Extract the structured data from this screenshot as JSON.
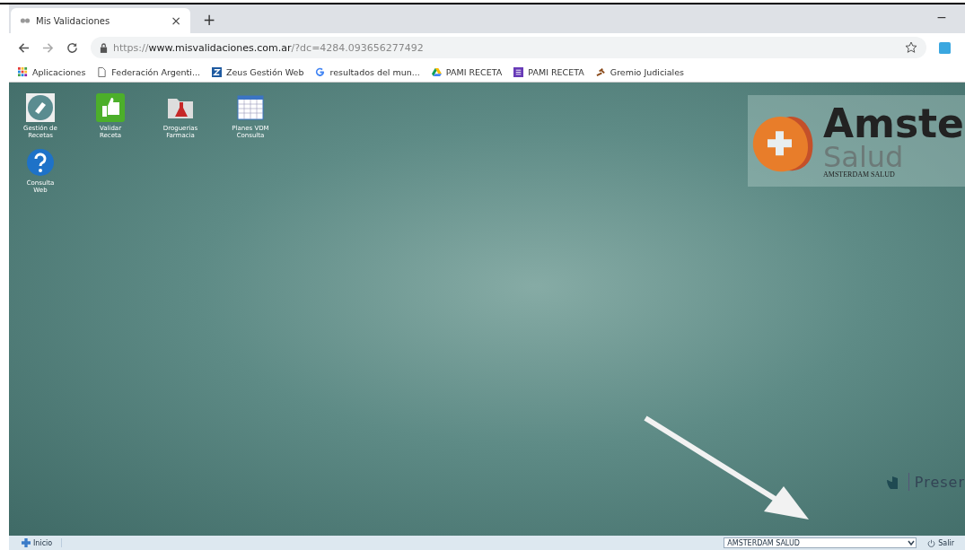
{
  "browser": {
    "tab": {
      "title": "Mis Validaciones",
      "close": "×"
    },
    "new_tab": "+",
    "minimize": "−",
    "url": {
      "scheme": "https://",
      "host": "www.misvalidaciones.com.ar",
      "path": "/?dc=4284.093656277492"
    },
    "bookmarks": [
      {
        "kind": "apps",
        "label": "Aplicaciones"
      },
      {
        "kind": "page",
        "label": "Federación Argenti..."
      },
      {
        "kind": "zeus",
        "label": "Zeus Gestión Web"
      },
      {
        "kind": "google",
        "label": "resultados del mun..."
      },
      {
        "kind": "drive",
        "label": "PAMI RECETA"
      },
      {
        "kind": "form",
        "label": "PAMI RECETA"
      },
      {
        "kind": "gavel",
        "label": "Gremio Judiciales"
      }
    ]
  },
  "desktop": {
    "icons": [
      {
        "kind": "recetas",
        "label": [
          "Gestión de",
          "Recetas"
        ]
      },
      {
        "kind": "thumb",
        "label": [
          "Validar",
          "Receta"
        ]
      },
      {
        "kind": "folder",
        "label": [
          "Droguerias",
          "Farmacia"
        ]
      },
      {
        "kind": "calendar",
        "label": [
          "Planes VDM",
          "Consulta"
        ]
      },
      {
        "kind": "help",
        "label": [
          "Consulta",
          "Web"
        ]
      }
    ],
    "logo": {
      "title": "Amste",
      "subtitle": "Salud",
      "caption": "AMSTERDAM SALUD"
    },
    "footer_brand": "Preser"
  },
  "taskbar": {
    "start": "Inicio",
    "entity_select": {
      "value": "AMSTERDAM SALUD"
    },
    "exit": "Salir"
  }
}
